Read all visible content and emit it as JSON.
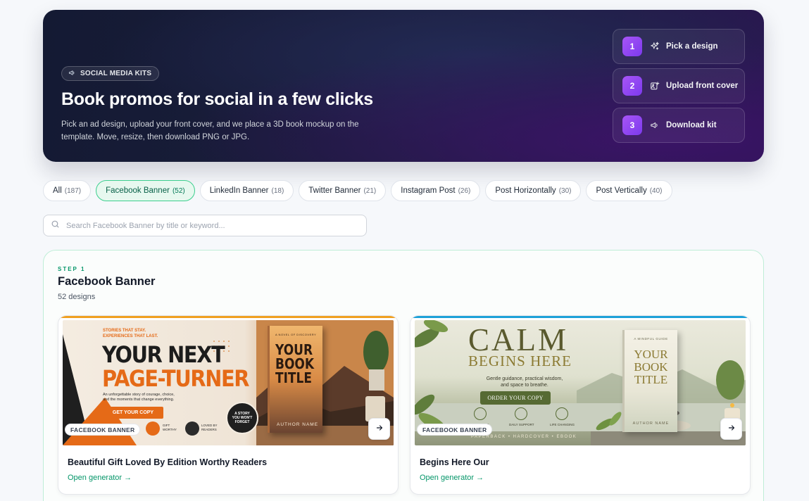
{
  "hero": {
    "tag": "SOCIAL MEDIA KITS",
    "title": "Book promos for social in a few clicks",
    "subtitle": "Pick an ad design, upload your front cover, and we place a 3D book mockup on the template. Move, resize, then download PNG or JPG.",
    "steps": [
      {
        "number": "1",
        "label": "Pick a design",
        "icon": "sparkles-icon"
      },
      {
        "number": "2",
        "label": "Upload front cover",
        "icon": "image-upload-icon"
      },
      {
        "number": "3",
        "label": "Download kit",
        "icon": "megaphone-icon"
      }
    ]
  },
  "filters": [
    {
      "label": "All",
      "count": "(187)",
      "active": false
    },
    {
      "label": "Facebook Banner",
      "count": "(52)",
      "active": true
    },
    {
      "label": "LinkedIn Banner",
      "count": "(18)",
      "active": false
    },
    {
      "label": "Twitter Banner",
      "count": "(21)",
      "active": false
    },
    {
      "label": "Instagram Post",
      "count": "(26)",
      "active": false
    },
    {
      "label": "Post Horizontally",
      "count": "(30)",
      "active": false
    },
    {
      "label": "Post Vertically",
      "count": "(40)",
      "active": false
    }
  ],
  "search": {
    "placeholder": "Search Facebook Banner by title or keyword..."
  },
  "panel": {
    "step_tag": "STEP 1",
    "title": "Facebook Banner",
    "count": "52 designs"
  },
  "cards": [
    {
      "badge": "FACEBOOK BANNER",
      "title": "Beautiful Gift Loved By Edition Worthy Readers",
      "link": "Open generator →",
      "accent": "#f59e0b",
      "art": {
        "kicker": "STORIES THAT STAY.\nEXPERIENCES THAT LAST.",
        "headline1": "YOUR NEXT",
        "headline2": "PAGE-TURNER",
        "body": "An unforgettable story of courage, choice,\nand the moments that change everything.",
        "cta": "GET YOUR COPY",
        "feat1": "GIFT\nWORTHY",
        "feat2": "LOVED BY\nREADERS",
        "book_title": "YOUR\nBOOK\nTITLE",
        "book_author": "AUTHOR NAME",
        "book_tagline": "A NOVEL OF DISCOVERY",
        "seal": "A STORY\nYOU WON'T\nFORGET"
      }
    },
    {
      "badge": "FACEBOOK BANNER",
      "title": "Begins Here Our",
      "link": "Open generator →",
      "accent": "#0ea5e9",
      "art": {
        "headline1": "CALM",
        "headline2": "BEGINS HERE",
        "body": "Gentle guidance, practical wisdom,\nand space to breathe.",
        "cta": "ORDER YOUR COPY",
        "feat1": "EASY READ",
        "feat2": "DAILY SUPPORT",
        "feat3": "LIFE CHANGING",
        "formats": "PAPERBACK  •  HARDCOVER  •  EBOOK",
        "book_kicker": "A MINDFUL GUIDE",
        "book_title": "YOUR\nBOOK\nTITLE",
        "book_author": "AUTHOR NAME"
      }
    }
  ]
}
